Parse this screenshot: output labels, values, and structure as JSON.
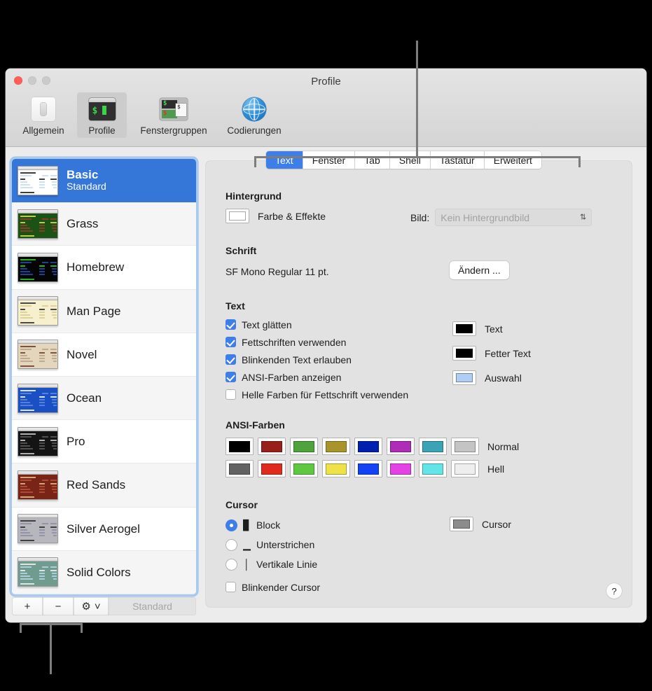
{
  "window": {
    "title": "Profile"
  },
  "toolbar": {
    "items": [
      {
        "label": "Allgemein",
        "icon": "general-icon",
        "selected": false
      },
      {
        "label": "Profile",
        "icon": "profiles-icon",
        "selected": true
      },
      {
        "label": "Fenstergruppen",
        "icon": "window-groups-icon",
        "selected": false
      },
      {
        "label": "Codierungen",
        "icon": "encodings-icon",
        "selected": false
      }
    ]
  },
  "sidebar": {
    "profiles": [
      {
        "name": "Basic",
        "sub": "Standard",
        "selected": true,
        "bg": "#ffffff",
        "fg": "#1b1b1b",
        "accent": "#c7d9f2",
        "title": "#e9e9e9"
      },
      {
        "name": "Grass",
        "sub": "",
        "selected": false,
        "bg": "#1c5216",
        "fg": "#d6e44f",
        "accent": "#9a3b2a",
        "title": "#5c7a4a"
      },
      {
        "name": "Homebrew",
        "sub": "",
        "selected": false,
        "bg": "#050505",
        "fg": "#27d427",
        "accent": "#1c4fb0",
        "title": "#3a3a3a"
      },
      {
        "name": "Man Page",
        "sub": "",
        "selected": false,
        "bg": "#f7f0cf",
        "fg": "#2b2b2b",
        "accent": "#d9cd8e",
        "title": "#e8e0b8"
      },
      {
        "name": "Novel",
        "sub": "",
        "selected": false,
        "bg": "#e4d6bd",
        "fg": "#6a3b2a",
        "accent": "#b9a383",
        "title": "#d3c3a6"
      },
      {
        "name": "Ocean",
        "sub": "",
        "selected": false,
        "bg": "#1b4fc4",
        "fg": "#ffffff",
        "accent": "#5f8ade",
        "title": "#3a6ad0"
      },
      {
        "name": "Pro",
        "sub": "",
        "selected": false,
        "bg": "#141414",
        "fg": "#cccccc",
        "accent": "#5a5a5a",
        "title": "#3b3b3b"
      },
      {
        "name": "Red Sands",
        "sub": "",
        "selected": false,
        "bg": "#7a2418",
        "fg": "#e0c089",
        "accent": "#b4543c",
        "title": "#9a3a28"
      },
      {
        "name": "Silver Aerogel",
        "sub": "",
        "selected": false,
        "bg": "#b6b6bc",
        "fg": "#2b2b2b",
        "accent": "#8e8ea4",
        "title": "#cfcfd4"
      },
      {
        "name": "Solid Colors",
        "sub": "",
        "selected": false,
        "bg": "#6f9c8e",
        "fg": "#f2f2f2",
        "accent": "#bcd4e6",
        "title": "#8db3a6"
      }
    ],
    "buttons": {
      "add": "+",
      "remove": "−",
      "gear": "⚙",
      "gear_chevron": "˅",
      "default": "Standard"
    }
  },
  "tabs": [
    {
      "label": "Text",
      "active": true
    },
    {
      "label": "Fenster",
      "active": false
    },
    {
      "label": "Tab",
      "active": false
    },
    {
      "label": "Shell",
      "active": false
    },
    {
      "label": "Tastatur",
      "active": false
    },
    {
      "label": "Erweitert",
      "active": false
    }
  ],
  "background": {
    "heading": "Hintergrund",
    "color_effects_label": "Farbe & Effekte",
    "color_well": "#ffffff",
    "image_label": "Bild:",
    "image_value": "Kein Hintergrundbild",
    "popup_arrows": "⇅"
  },
  "font": {
    "heading": "Schrift",
    "value": "SF Mono Regular 11 pt.",
    "change_button": "Ändern ..."
  },
  "text": {
    "heading": "Text",
    "checkboxes": [
      {
        "label": "Text glätten",
        "checked": true
      },
      {
        "label": "Fettschriften verwenden",
        "checked": true
      },
      {
        "label": "Blinkenden Text erlauben",
        "checked": true
      },
      {
        "label": "ANSI-Farben anzeigen",
        "checked": true
      },
      {
        "label": "Helle Farben für Fettschrift verwenden",
        "checked": false
      }
    ],
    "wells": [
      {
        "label": "Text",
        "color": "#000000"
      },
      {
        "label": "Fetter Text",
        "color": "#000000"
      },
      {
        "label": "Auswahl",
        "color": "#b0cdf5"
      }
    ]
  },
  "ansi": {
    "heading": "ANSI-Farben",
    "normal_label": "Normal",
    "bright_label": "Hell",
    "normal": [
      "#000000",
      "#99201a",
      "#4ea33c",
      "#a89428",
      "#0020b0",
      "#ae2cb8",
      "#3aa3b5",
      "#c4c4c4"
    ],
    "bright": [
      "#626262",
      "#e02a1e",
      "#5ec940",
      "#efe249",
      "#1343f5",
      "#e442e4",
      "#63e5e8",
      "#eeeeee"
    ]
  },
  "cursor": {
    "heading": "Cursor",
    "options": [
      {
        "label": "Block",
        "glyph": "▊",
        "selected": true
      },
      {
        "label": "Unterstrichen",
        "glyph": "▁",
        "selected": false
      },
      {
        "label": "Vertikale Linie",
        "glyph": "│",
        "selected": false
      }
    ],
    "blink": {
      "label": "Blinkender Cursor",
      "checked": false
    },
    "well": {
      "label": "Cursor",
      "color": "#8c8c8c"
    }
  },
  "help": {
    "label": "?"
  }
}
